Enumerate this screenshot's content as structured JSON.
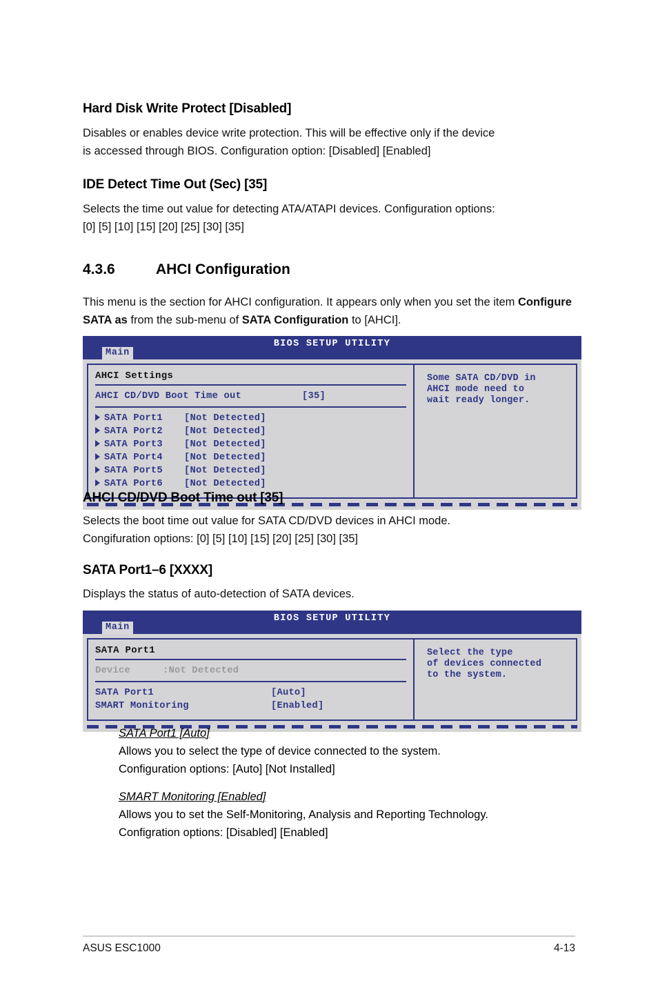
{
  "doc": {
    "footer_left": "ASUS ESC1000",
    "footer_right": "4-13"
  },
  "sections": {
    "hard_disk_write_protect": {
      "heading": "Hard Disk Write Protect [Disabled]",
      "body_line1": "Disables or enables device write protection. This will be effective only if the device",
      "body_line2": "is accessed through BIOS. Configuration option: [Disabled] [Enabled]"
    },
    "ide_detect_time_out": {
      "heading": "IDE Detect Time Out (Sec) [35]",
      "body_line1": "Selects the time out value for detecting ATA/ATAPI devices. Configuration options:",
      "body_line2": "[0] [5] [10] [15] [20] [25] [30] [35]"
    },
    "ahci_configuration": {
      "number": "4.3.6",
      "title": "AHCI Configuration",
      "intro_part1": "This menu is the section for AHCI configuration. It appears only when you set the item ",
      "intro_bold1": "Configure SATA as",
      "intro_part2": " from the sub-menu of ",
      "intro_bold2": "SATA Configuration",
      "intro_part3": " to [AHCI]."
    },
    "ahci_cd_dvd_boot_time_out": {
      "heading": "AHCI CD/DVD Boot Time out [35]",
      "body_line1": "Selects the boot time out value for SATA CD/DVD devices in AHCI mode.",
      "body_line2": "Congifuration options: [0] [5] [10] [15] [20] [25] [30] [35]"
    },
    "sata_port_1_6": {
      "heading": "SATA Port1–6 [XXXX]",
      "body_line1": "Displays the status of auto-detection of SATA devices."
    },
    "sata_port1_sub": {
      "heading": "SATA Port1 [Auto]",
      "body_line1": "Allows you to select the type of device connected to the system.",
      "body_line2": "Configuration options: [Auto] [Not Installed]"
    },
    "smart_monitoring_sub": {
      "heading": "SMART Monitoring [Enabled]",
      "body_line1": "Allows you to set the Self-Monitoring, Analysis and Reporting Technology.",
      "body_line2": "Configration options: [Disabled] [Enabled]"
    }
  },
  "bios_screen_1": {
    "title": "BIOS SETUP UTILITY",
    "tab": "Main",
    "group_title": "AHCI Settings",
    "setting": {
      "label": "AHCI CD/DVD Boot Time out",
      "value": "[35]"
    },
    "ports": [
      {
        "label": "SATA Port1",
        "value": "[Not Detected]"
      },
      {
        "label": "SATA Port2",
        "value": "[Not Detected]"
      },
      {
        "label": "SATA Port3",
        "value": "[Not Detected]"
      },
      {
        "label": "SATA Port4",
        "value": "[Not Detected]"
      },
      {
        "label": "SATA Port5",
        "value": "[Not Detected]"
      },
      {
        "label": "SATA Port6",
        "value": "[Not Detected]"
      }
    ],
    "help": [
      "Some SATA CD/DVD in",
      "AHCI mode need to",
      "wait ready longer."
    ]
  },
  "bios_screen_2": {
    "title": "BIOS SETUP UTILITY",
    "tab": "Main",
    "group_title": "SATA Port1",
    "device": {
      "label": "Device",
      "value": ":Not Detected"
    },
    "settings": [
      {
        "label": "SATA Port1",
        "value": "[Auto]"
      },
      {
        "label": "SMART Monitoring",
        "value": "[Enabled]"
      }
    ],
    "help": [
      "Select the type",
      "of devices connected",
      "to the system."
    ]
  },
  "colors": {
    "bios_blue": "#2f3686",
    "bios_bg": "#d4d4d6",
    "bios_tab_bg": "#d8d8dc",
    "bios_disabled_text": "#9a9a9a"
  }
}
